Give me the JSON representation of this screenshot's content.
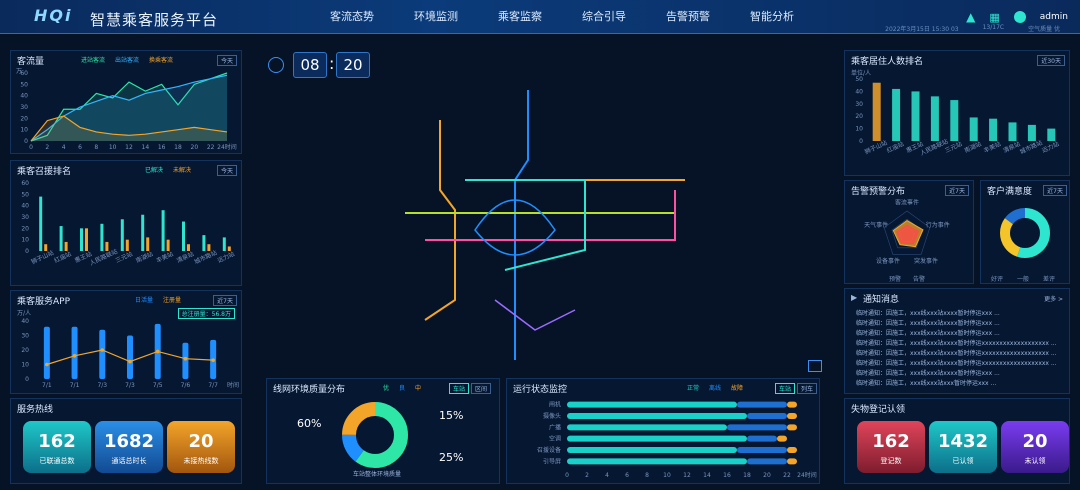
{
  "header": {
    "logo": "HQi",
    "title": "智慧乘客服务平台",
    "nav": [
      "客流态势",
      "环境监测",
      "乘客监察",
      "综合引导",
      "告警预警",
      "智能分析"
    ],
    "user": "admin",
    "date": "2022年3月15日 15:30 03",
    "weather": "13/17C",
    "air": "空气质量 优"
  },
  "clock": {
    "hour": "08",
    "minute": "20"
  },
  "passenger_flow": {
    "title": "客流量",
    "legend": [
      "进站客流",
      "出站客流",
      "换乘客流"
    ],
    "badge": "今天",
    "ylabel": "万",
    "xlabel": "24时间"
  },
  "help_rank": {
    "title": "乘客召援排名",
    "legend": [
      "已解决",
      "未解决"
    ],
    "badge": "今天"
  },
  "app": {
    "title": "乘客服务APP",
    "legend": [
      "日活量",
      "注册量"
    ],
    "badge": "近7天",
    "total": "总注册量：56.8万",
    "unit": "万/人",
    "xlabel": "时间"
  },
  "hotline": {
    "title": "服务热线",
    "cards": [
      {
        "value": "162",
        "label": "已联通总数"
      },
      {
        "value": "1682",
        "label": "通话总时长"
      },
      {
        "value": "20",
        "label": "未接热线数"
      }
    ]
  },
  "env": {
    "title": "线网环境质量分布",
    "legend": [
      "优",
      "良",
      "中"
    ],
    "badges": [
      "车站",
      "区间"
    ],
    "caption": "车站整体环境质量",
    "labels": [
      "60%",
      "15%",
      "25%"
    ]
  },
  "ops": {
    "title": "运行状态监控",
    "legend": [
      "正常",
      "离线",
      "故障"
    ],
    "badges": [
      "车站",
      "列车"
    ],
    "rows": [
      "闸机",
      "摄像头",
      "广播",
      "空调",
      "召援设备",
      "引导屏"
    ],
    "xticks": [
      "0",
      "2",
      "4",
      "6",
      "8",
      "10",
      "12",
      "14",
      "16",
      "18",
      "20",
      "22",
      "24时间"
    ]
  },
  "residence": {
    "title": "乘客居住人数排名",
    "badge": "近30天",
    "unit": "单位/人"
  },
  "alarm": {
    "title": "告警预警分布",
    "badge": "近7天",
    "axes": [
      "客流事件",
      "行为事件",
      "突发事件",
      "设备事件",
      "天气事件"
    ],
    "legend": [
      "预警",
      "告警"
    ]
  },
  "satisfaction": {
    "title": "客户满意度",
    "badge": "近7天",
    "legend": [
      "好评",
      "一般",
      "差评"
    ]
  },
  "notices": {
    "title": "通知消息",
    "more": "更多 >",
    "items": [
      "临时通知：因施工，xxx线xxx站xxxx暂时停运xxx ...",
      "临时通知：因施工，xxx线xxx站xxxx暂时停运xxx ...",
      "临时通知：因施工，xxx线xxx站xxxx暂时停运xxx ...",
      "临时通知：因施工，xxx线xxx站xxxx暂时停运xxxxxxxxxxxxxxxxxxx ...",
      "临时通知：因施工，xxx线xxx站xxxx暂时停运xxxxxxxxxxxxxxxxxxx ...",
      "临时通知：因施工，xxx线xxx站xxxx暂时停运xxxxxxxxxxxxxxxxxxx ...",
      "临时通知：因施工，xxx线xxx站xxxx暂时停运xxx ...",
      "临时通知：因施工，xxx线xxx站xxx暂时停运xxx ..."
    ]
  },
  "lost_found": {
    "title": "失物登记认领",
    "cards": [
      {
        "value": "162",
        "label": "登记数"
      },
      {
        "value": "1432",
        "label": "已认领"
      },
      {
        "value": "20",
        "label": "未认领"
      }
    ]
  },
  "chart_data": [
    {
      "type": "line",
      "name_ref": "passenger_flow",
      "x": [
        0,
        2,
        4,
        6,
        8,
        10,
        12,
        14,
        16,
        18,
        20,
        22,
        24
      ],
      "series": [
        {
          "name": "进站客流",
          "values": [
            0,
            5,
            28,
            28,
            42,
            38,
            52,
            44,
            50,
            32,
            50,
            55,
            60
          ],
          "color": "#2ee6a6"
        },
        {
          "name": "出站客流",
          "values": [
            0,
            10,
            22,
            30,
            35,
            40,
            36,
            42,
            45,
            48,
            52,
            55,
            58
          ],
          "color": "#34b4ff"
        },
        {
          "name": "换乘客流",
          "values": [
            0,
            18,
            22,
            12,
            8,
            6,
            5,
            6,
            8,
            10,
            12,
            10,
            8
          ],
          "color": "#f3a52a"
        }
      ],
      "ylim": [
        0,
        60
      ]
    },
    {
      "type": "bar",
      "name_ref": "help_rank",
      "categories": [
        "狮子山站",
        "红庙站",
        "惠王站",
        "人民路联站",
        "三元站",
        "南湖站",
        "丰美站",
        "清泉站",
        "城市路站",
        "远力站"
      ],
      "series": [
        {
          "name": "已解决",
          "values": [
            48,
            22,
            20,
            24,
            28,
            32,
            36,
            26,
            14,
            12
          ],
          "color": "#2ee6d0"
        },
        {
          "name": "未解决",
          "values": [
            6,
            8,
            20,
            8,
            10,
            12,
            10,
            6,
            6,
            4
          ],
          "color": "#f3a52a"
        }
      ],
      "ylim": [
        0,
        60
      ]
    },
    {
      "type": "bar",
      "name_ref": "app",
      "categories": [
        "7/1",
        "7/1",
        "7/3",
        "7/3",
        "7/5",
        "7/6",
        "7/7"
      ],
      "series": [
        {
          "name": "日活量",
          "values": [
            36,
            36,
            34,
            30,
            38,
            25,
            27
          ],
          "color": "#1f8fff"
        },
        {
          "name": "注册量",
          "values": [
            10,
            16,
            20,
            12,
            19,
            14,
            13
          ],
          "color": "#f3a52a"
        }
      ],
      "ylim": [
        0,
        40
      ]
    },
    {
      "type": "pie",
      "name_ref": "env",
      "categories": [
        "优",
        "良",
        "中"
      ],
      "values": [
        60,
        15,
        25
      ],
      "colors": [
        "#2ee6a6",
        "#1f8fff",
        "#f3a52a"
      ]
    },
    {
      "type": "bar",
      "name_ref": "ops",
      "categories": [
        "闸机",
        "摄像头",
        "广播",
        "空调",
        "召援设备",
        "引导屏"
      ],
      "series": [
        {
          "name": "正常",
          "values": [
            17,
            18,
            16,
            18,
            17,
            18
          ],
          "color": "#19d1c8"
        },
        {
          "name": "离线",
          "values": [
            5,
            4,
            6,
            3,
            5,
            4
          ],
          "color": "#1f6fd0"
        },
        {
          "name": "故障",
          "values": [
            1,
            1,
            1,
            1,
            1,
            1
          ],
          "color": "#f3a52a"
        }
      ],
      "xlim": [
        0,
        24
      ]
    },
    {
      "type": "bar",
      "name_ref": "residence",
      "categories": [
        "狮子山站",
        "红庙站",
        "惠王站",
        "人民路联站",
        "三元站",
        "南湖站",
        "丰美站",
        "清泉站",
        "城市路站",
        "远力站"
      ],
      "values": [
        47,
        42,
        40,
        36,
        33,
        19,
        18,
        15,
        13,
        10
      ],
      "ylim": [
        0,
        50
      ]
    },
    {
      "type": "radar",
      "name_ref": "alarm",
      "categories": [
        "客流事件",
        "行为事件",
        "突发事件",
        "设备事件",
        "天气事件"
      ],
      "series": [
        {
          "name": "预警",
          "values": [
            0.6,
            0.7,
            0.6,
            0.5,
            0.6
          ],
          "color": "#f3a52a"
        },
        {
          "name": "告警",
          "values": [
            0.4,
            0.5,
            0.45,
            0.4,
            0.45
          ],
          "color": "#ff4a4a"
        }
      ]
    },
    {
      "type": "pie",
      "name_ref": "satisfaction",
      "categories": [
        "好评",
        "一般",
        "差评"
      ],
      "values": [
        55,
        30,
        15
      ],
      "colors": [
        "#2ee6d0",
        "#f3c52a",
        "#1f6fd0"
      ]
    }
  ]
}
